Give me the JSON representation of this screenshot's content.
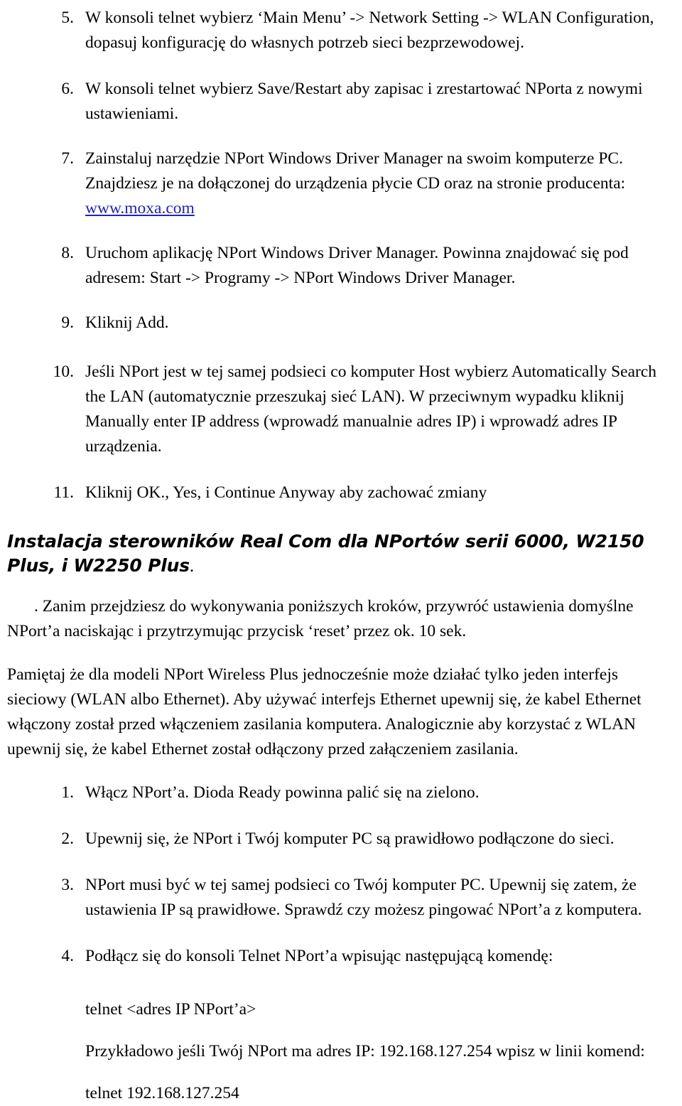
{
  "document": {
    "language": "pl",
    "link_color": "#2323b0",
    "text_color": "#000000",
    "background_color": "#ffffff"
  },
  "list_a": {
    "items": [
      {
        "marker": "5.",
        "text": "W konsoli telnet wybierz ‘Main Menu’ -> Network Setting -> WLAN Configuration, dopasuj konfigurację do własnych potrzeb sieci bezprzewodowej."
      },
      {
        "marker": "6.",
        "text": "W konsoli telnet wybierz Save/Restart aby zapisac i zrestartować NPorta z nowymi ustawieniami."
      },
      {
        "marker": "7.",
        "text_before_link": "Zainstaluj narzędzie NPort Windows Driver Manager na swoim komputerze PC. Znajdziesz je na dołączonej do urządzenia płycie CD oraz na stronie producenta: ",
        "link_text": "www.moxa.com"
      },
      {
        "marker": "8.",
        "text": "Uruchom aplikację NPort Windows Driver Manager. Powinna znajdować się pod adresem: Start -> Programy -> NPort Windows Driver Manager."
      },
      {
        "marker": "9.",
        "text": "Kliknij Add."
      },
      {
        "marker": "10.",
        "text": "Jeśli NPort jest w tej samej podsieci co komputer Host wybierz Automatically Search the LAN (automatycznie przeszukaj sieć LAN). W przeciwnym wypadku kliknij Manually enter IP address (wprowadź manualnie adres IP) i wprowadź adres IP urządzenia."
      },
      {
        "marker": "11.",
        "text": "Kliknij OK., Yes, i Continue Anyway aby zachować zmiany"
      }
    ]
  },
  "heading": {
    "main": "Instalacja sterowników Real Com dla NPortów serii 6000, W2150 Plus, i W2250 Plus",
    "tail": "."
  },
  "paragraphs": {
    "reset_note": ". Zanim przejdziesz do wykonywania poniższych kroków, przywróć ustawienia domyślne NPort’a naciskając i przytrzymując przycisk ‘reset’ przez ok. 10 sek.",
    "interface_note": "Pamiętaj że dla modeli NPort Wireless Plus jednocześnie może działać tylko jeden interfejs sieciowy (WLAN albo Ethernet). Aby używać interfejs Ethernet upewnij się, że kabel Ethernet włączony został przed włączeniem zasilania komputera. Analogicznie aby korzystać z WLAN upewnij się, że kabel Ethernet został odłączony przed załączeniem zasilania."
  },
  "list_b": {
    "items": [
      {
        "marker": "1.",
        "text": "Włącz NPort’a. Dioda Ready powinna palić się na zielono."
      },
      {
        "marker": "2.",
        "text": "Upewnij się, że NPort i Twój komputer PC są prawidłowo podłączone do sieci."
      },
      {
        "marker": "3.",
        "text": "NPort musi być w tej samej podsieci co Twój komputer PC. Upewnij się zatem, że ustawienia IP są prawidłowe. Sprawdź czy możesz pingować NPort’a z komputera."
      },
      {
        "marker": "4.",
        "text": "Podłącz się do konsoli Telnet NPort’a wpisując następującą komendę:"
      }
    ]
  },
  "commands": {
    "telnet_template": "telnet <adres IP NPort’a>",
    "example_intro": "Przykładowo jeśli Twój NPort ma adres IP: 192.168.127.254 wpisz w linii komend:",
    "telnet_example": "telnet 192.168.127.254"
  }
}
